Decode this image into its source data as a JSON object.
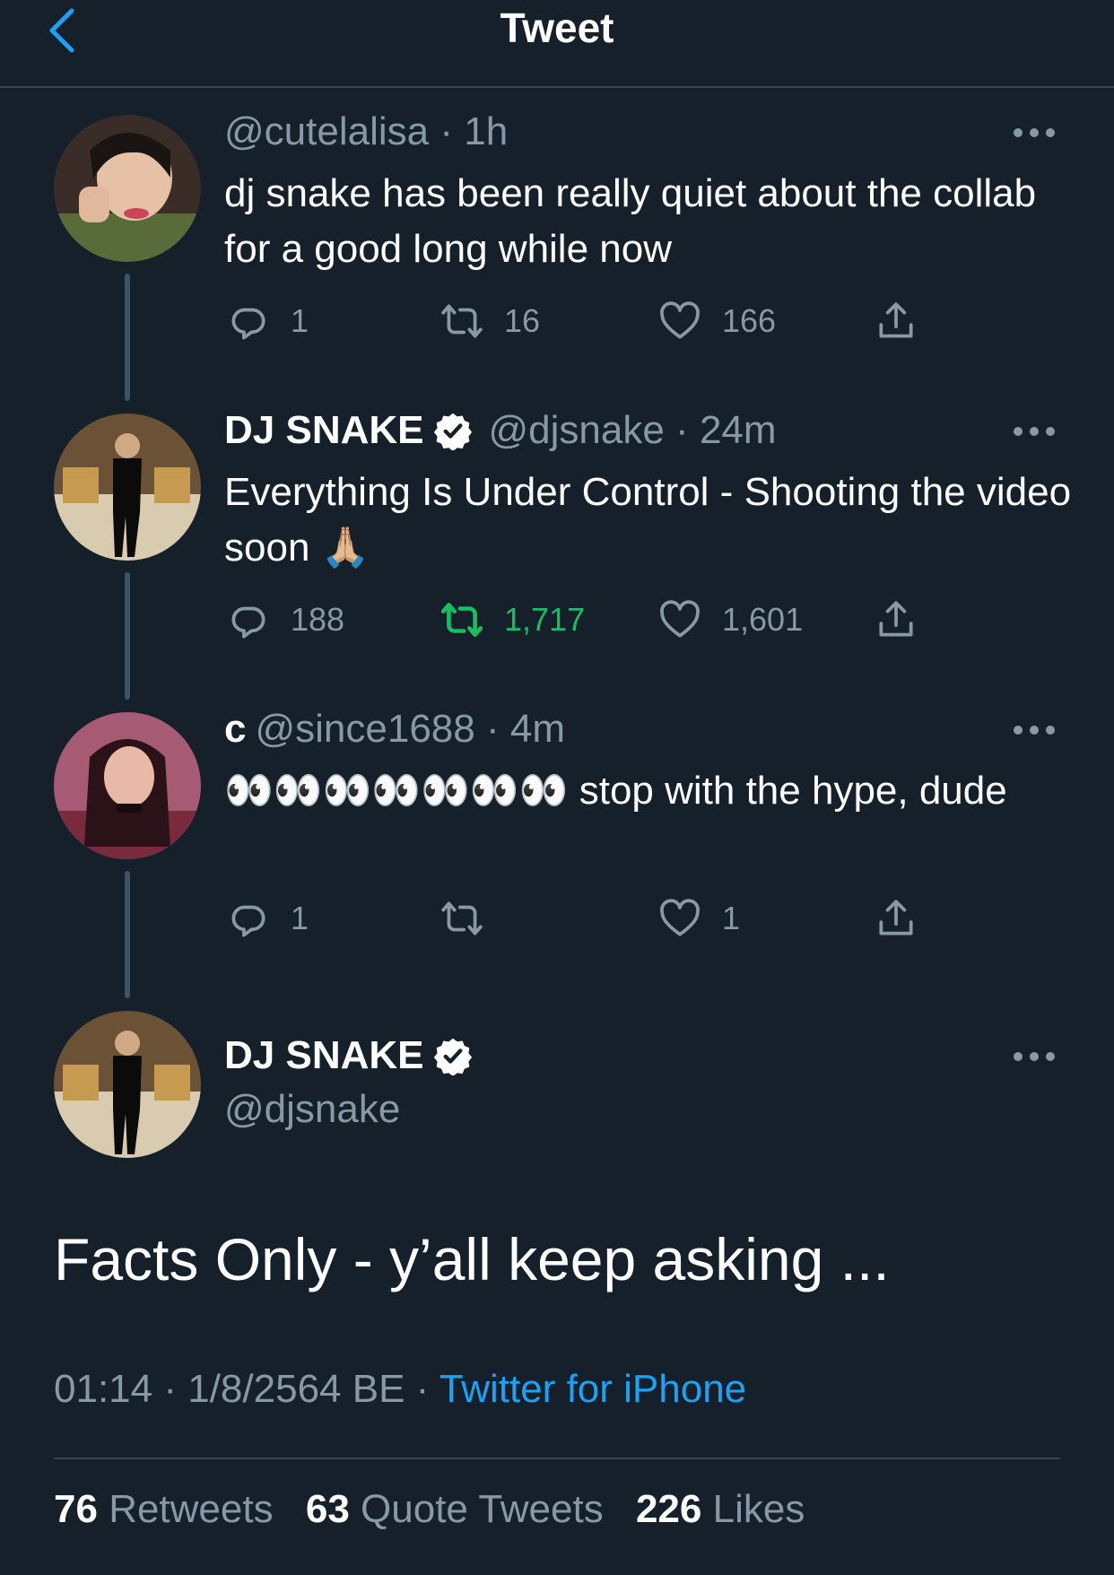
{
  "header": {
    "title": "Tweet"
  },
  "thread": [
    {
      "name": "",
      "handle": "@cutelalisa",
      "time": "1h",
      "text": "dj snake has been really quiet about the collab for a good long while now",
      "replies": "1",
      "retweets": "16",
      "likes": "166"
    },
    {
      "name": "DJ SNAKE",
      "handle": "@djsnake",
      "time": "24m",
      "text": "Everything Is Under Control - Shooting the video soon 🙏🏼",
      "replies": "188",
      "retweets": "1,717",
      "likes": "1,601"
    },
    {
      "name": "c",
      "handle": "@since1688",
      "time": "4m",
      "text": "👀👀👀👀👀👀👀 stop with the hype, dude",
      "replies": "1",
      "retweets": "",
      "likes": "1"
    }
  ],
  "main_tweet": {
    "name": "DJ SNAKE",
    "handle": "@djsnake",
    "text": "Facts Only - y’all keep asking ...",
    "time": "01:14",
    "date": "1/8/2564 BE",
    "source": "Twitter for iPhone",
    "retweets": "76",
    "retweets_label": "Retweets",
    "quote_tweets": "63",
    "quote_tweets_label": "Quote Tweets",
    "likes": "226",
    "likes_label": "Likes"
  },
  "colors": {
    "background": "#15202b",
    "secondary_text": "#8899a6",
    "accent": "#1da1f2",
    "retweet_active": "#17bf63",
    "divider": "#38444d"
  }
}
